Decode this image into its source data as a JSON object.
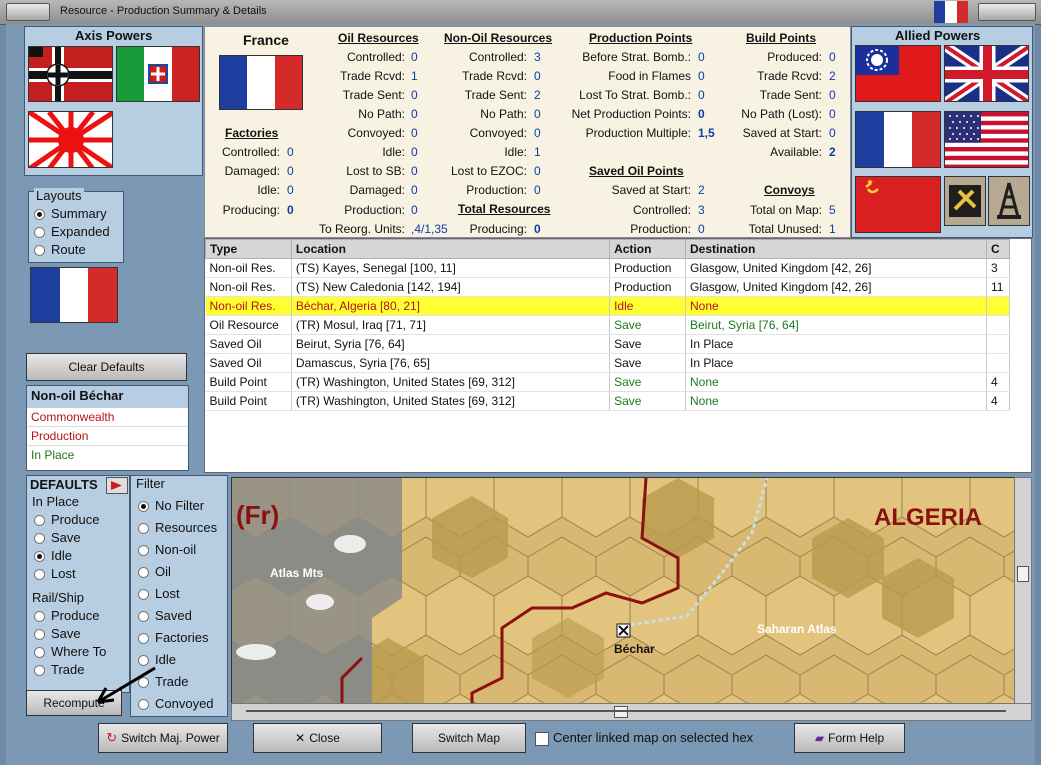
{
  "window": {
    "title": "Resource - Production Summary & Details"
  },
  "axis": {
    "title": "Axis Powers"
  },
  "allied": {
    "title": "Allied Powers"
  },
  "country": {
    "name": "France"
  },
  "factories": {
    "header": "Factories",
    "rows": [
      {
        "label": "Controlled:",
        "value": "0"
      },
      {
        "label": "Damaged:",
        "value": "0"
      },
      {
        "label": "Idle:",
        "value": "0"
      },
      {
        "label": "Producing:",
        "value": "0"
      }
    ]
  },
  "oil": {
    "header": "Oil Resources",
    "rows": [
      {
        "label": "Controlled:",
        "value": "0"
      },
      {
        "label": "Trade Rcvd:",
        "value": "1"
      },
      {
        "label": "Trade Sent:",
        "value": "0"
      },
      {
        "label": "No Path:",
        "value": "0"
      },
      {
        "label": "Convoyed:",
        "value": "0"
      },
      {
        "label": "Idle:",
        "value": "0"
      },
      {
        "label": "Lost to SB:",
        "value": "0"
      },
      {
        "label": "Damaged:",
        "value": "0"
      },
      {
        "label": "Production:",
        "value": "0"
      },
      {
        "label": "To Reorg. Units:",
        "value": ",4/1,35"
      }
    ]
  },
  "nonoil": {
    "header": "Non-Oil Resources",
    "rows": [
      {
        "label": "Controlled:",
        "value": "3"
      },
      {
        "label": "Trade Rcvd:",
        "value": "0"
      },
      {
        "label": "Trade Sent:",
        "value": "2"
      },
      {
        "label": "No Path:",
        "value": "0"
      },
      {
        "label": "Convoyed:",
        "value": "0"
      },
      {
        "label": "Idle:",
        "value": "1"
      },
      {
        "label": "Lost to EZOC:",
        "value": "0"
      },
      {
        "label": "Production:",
        "value": "0"
      }
    ]
  },
  "total": {
    "header": "Total Resources",
    "label": "Producing:",
    "value": "0"
  },
  "pp": {
    "header": "Production Points",
    "rows": [
      {
        "label": "Before Strat. Bomb.:",
        "value": "0"
      },
      {
        "label": "Food in Flames",
        "value": "0"
      },
      {
        "label": "Lost To Strat. Bomb.:",
        "value": "0"
      },
      {
        "label": "Net Production Points:",
        "value": "0"
      },
      {
        "label": "Production Multiple:",
        "value": "1,5"
      }
    ]
  },
  "savedoil": {
    "header": "Saved Oil Points",
    "rows": [
      {
        "label": "Saved at Start:",
        "value": "2"
      },
      {
        "label": "Controlled:",
        "value": "3"
      },
      {
        "label": "Production:",
        "value": "0"
      }
    ]
  },
  "bp": {
    "header": "Build Points",
    "rows": [
      {
        "label": "Produced:",
        "value": "0"
      },
      {
        "label": "Trade Rcvd:",
        "value": "2"
      },
      {
        "label": "Trade Sent:",
        "value": "0"
      },
      {
        "label": "No Path (Lost):",
        "value": "0"
      },
      {
        "label": "Saved at Start:",
        "value": "0"
      },
      {
        "label": "Available:",
        "value": "2"
      }
    ]
  },
  "convoys": {
    "header": "Convoys",
    "rows": [
      {
        "label": "Total on Map:",
        "value": "5"
      },
      {
        "label": "Total Unused:",
        "value": "1"
      }
    ]
  },
  "layouts": {
    "title": "Layouts",
    "options": [
      "Summary",
      "Expanded",
      "Route"
    ],
    "selected": "Summary"
  },
  "clear_defaults": "Clear Defaults",
  "selection": {
    "title": "Non-oil Béchar",
    "lines": [
      "Commonwealth",
      "Production",
      "In Place"
    ]
  },
  "defaults": {
    "title": "DEFAULTS",
    "inplace": {
      "title": "In Place",
      "options": [
        "Produce",
        "Save",
        "Idle",
        "Lost"
      ],
      "selected": "Idle"
    },
    "railship": {
      "title": "Rail/Ship",
      "options": [
        "Produce",
        "Save",
        "Where To",
        "Trade"
      ]
    }
  },
  "filter": {
    "title": "Filter",
    "options": [
      "No Filter",
      "Resources",
      "Non-oil",
      "Oil",
      "Lost",
      "Saved",
      "Factories",
      "Idle",
      "Trade",
      "Convoyed"
    ],
    "selected": "No Filter"
  },
  "recompute": "Recompute",
  "table": {
    "headers": [
      "Type",
      "Location",
      "Action",
      "Destination",
      "C"
    ],
    "rows": [
      {
        "type": "Non-oil Res.",
        "location": "(TS) Kayes, Senegal [100, 11]",
        "action": "Production",
        "destination": "Glasgow, United Kingdom [42, 26]",
        "c": "3"
      },
      {
        "type": "Non-oil Res.",
        "location": "(TS) New Caledonia [142, 194]",
        "action": "Production",
        "destination": "Glasgow, United Kingdom [42, 26]",
        "c": "11"
      },
      {
        "type": "Non-oil Res.",
        "location": "Béchar, Algeria [80, 21]",
        "action": "Idle",
        "destination": "None",
        "c": ""
      },
      {
        "type": "Oil Resource",
        "location": "(TR) Mosul, Iraq [71, 71]",
        "action": "Save",
        "destination": "Beirut, Syria [76, 64]",
        "c": ""
      },
      {
        "type": "Saved Oil",
        "location": "Beirut, Syria [76, 64]",
        "action": "Save",
        "destination": "In Place",
        "c": ""
      },
      {
        "type": "Saved Oil",
        "location": "Damascus, Syria [76, 65]",
        "action": "Save",
        "destination": "In Place",
        "c": ""
      },
      {
        "type": "Build Point",
        "location": "(TR) Washington, United States [69, 312]",
        "action": "Save",
        "destination": "None",
        "c": "4"
      },
      {
        "type": "Build Point",
        "location": "(TR) Washington, United States [69, 312]",
        "action": "Save",
        "destination": "None",
        "c": "4"
      }
    ]
  },
  "map": {
    "tag": "(Fr)",
    "region": "ALGERIA",
    "labels": {
      "atlas": "Atlas Mts",
      "saharan": "Saharan Atlas",
      "bechar": "Béchar"
    }
  },
  "bottom": {
    "switch_power": "Switch Maj. Power",
    "close": "Close",
    "switch_map": "Switch Map",
    "center_label": "Center linked map on selected hex",
    "form_help": "Form Help"
  },
  "colors": {
    "accent_blue": "#0b3ea8",
    "highlight": "#ffff33",
    "panel_bg": "#b7cde2",
    "green_text": "#1d7a1d",
    "red_text": "#b41414"
  }
}
